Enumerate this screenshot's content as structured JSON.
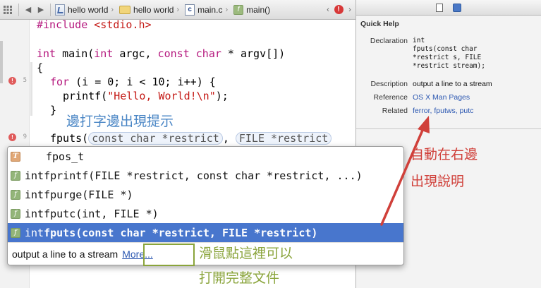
{
  "jumpbar": {
    "breadcrumbs": [
      "hello world",
      "hello world",
      "main.c",
      "main()"
    ]
  },
  "editor": {
    "gutter": {
      "line_numbers": [
        "5",
        "9"
      ]
    },
    "lines": {
      "include_kw": "#include",
      "include_file": "<stdio.h>",
      "main_int": "int",
      "main_rest_1": " main(",
      "main_int2": "int",
      "main_rest_2": " argc, ",
      "main_const": "const",
      "main_space": " ",
      "main_char": "char",
      "main_rest_3": " * argv[])",
      "brace_open": "{",
      "for_kw": "for",
      "for_rest_1": " (i = 0; i < 10; i++) {",
      "printf_call": "printf(",
      "printf_string": "\"Hello, World!\\n\"",
      "printf_end": ");",
      "brace_close": "}",
      "fputs_prefix": "fputs(",
      "fputs_token1": "const char *restrict",
      "fputs_comma": ", ",
      "fputs_token2": "FILE *restrict"
    },
    "annotation_left": "邊打字邊出現提示"
  },
  "completion": {
    "items": [
      {
        "kind": "T",
        "return_type": "",
        "signature": "fpos_t",
        "selected": false
      },
      {
        "kind": "f",
        "return_type": "int",
        "signature": "fprintf(FILE *restrict, const char *restrict, ...)",
        "selected": false
      },
      {
        "kind": "f",
        "return_type": "int",
        "signature": "fpurge(FILE *)",
        "selected": false
      },
      {
        "kind": "f",
        "return_type": "int",
        "signature": "fputc(int, FILE *)",
        "selected": false
      },
      {
        "kind": "f",
        "return_type": "int",
        "signature": "fputs(const char *restrict, FILE *restrict)",
        "selected": true
      }
    ],
    "description": "output a line to a stream",
    "more_label": "More..."
  },
  "annotations": {
    "right": [
      "自動在右邊",
      "出現說明"
    ],
    "bottom": [
      "滑鼠點這裡可以",
      "打開完整文件"
    ]
  },
  "quick_help": {
    "title": "Quick Help",
    "declaration_label": "Declaration",
    "declaration_lines": [
      "int",
      "fputs(const char",
      "*restrict s, FILE",
      "*restrict stream);"
    ],
    "description_label": "Description",
    "description_value": "output a line to a stream",
    "reference_label": "Reference",
    "reference_value": "OS X Man Pages",
    "related_label": "Related",
    "related_value": "ferror, fputws, putc"
  },
  "colors": {
    "keyword": "#b5187e",
    "string": "#c41a16",
    "selection": "#4876cd",
    "annotation_blue": "#4a86c5",
    "annotation_red": "#d0403a",
    "annotation_green": "#8aa43b",
    "arrow_red": "#d0403a"
  },
  "icons": [
    "grid-icon",
    "back-icon",
    "forward-icon",
    "project-icon",
    "folder-icon",
    "c-file-icon",
    "function-icon",
    "error-icon",
    "document-icon",
    "help-icon"
  ]
}
